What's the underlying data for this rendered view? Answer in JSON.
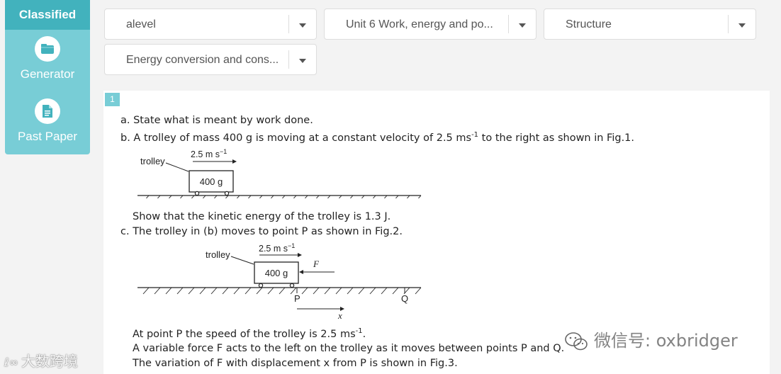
{
  "sidebar": {
    "active_tab": "Classified",
    "items": [
      {
        "label": "Generator",
        "icon": "folder-icon"
      },
      {
        "label": "Past Paper",
        "icon": "document-icon"
      }
    ]
  },
  "filters": {
    "level": "alevel",
    "unit": "Unit 6 Work, energy and po...",
    "type": "Structure",
    "topic": "Energy conversion and cons..."
  },
  "question": {
    "number": "1",
    "part_a": "a. State what is meant by work done.",
    "part_b_pre": "b. A trolley of mass 400 g is moving at a constant velocity of 2.5 ms",
    "part_b_sup": "-1",
    "part_b_post": " to the right as shown in Fig.1.",
    "part_b_show": "Show that the kinetic energy of the trolley is 1.3 J.",
    "part_c": "c. The trolley in (b) moves to point P as shown in Fig.2.",
    "line_speed_pre": "At point P the speed of the trolley is 2.5 ms",
    "line_speed_sup": "-1",
    "line_speed_post": ".",
    "line_force": "A variable force F acts to the left on the trolley as it moves between points P and Q.",
    "line_variation": "The variation of F with displacement x from P is shown in Fig.3."
  },
  "fig1": {
    "trolley_label": "trolley",
    "speed_label": "2.5 m s",
    "speed_sup": "−1",
    "mass_label": "400 g"
  },
  "fig2": {
    "trolley_label": "trolley",
    "speed_label": "2.5 m s",
    "speed_sup": "−1",
    "mass_label": "400 g",
    "force_label": "F",
    "point_p": "P",
    "point_q": "Q",
    "x_label": "x"
  },
  "watermarks": {
    "left": "大数跨境",
    "right": "微信号: oxbridger"
  },
  "colors": {
    "accent": "#42b2bd",
    "sidebar": "#78cdd6"
  }
}
